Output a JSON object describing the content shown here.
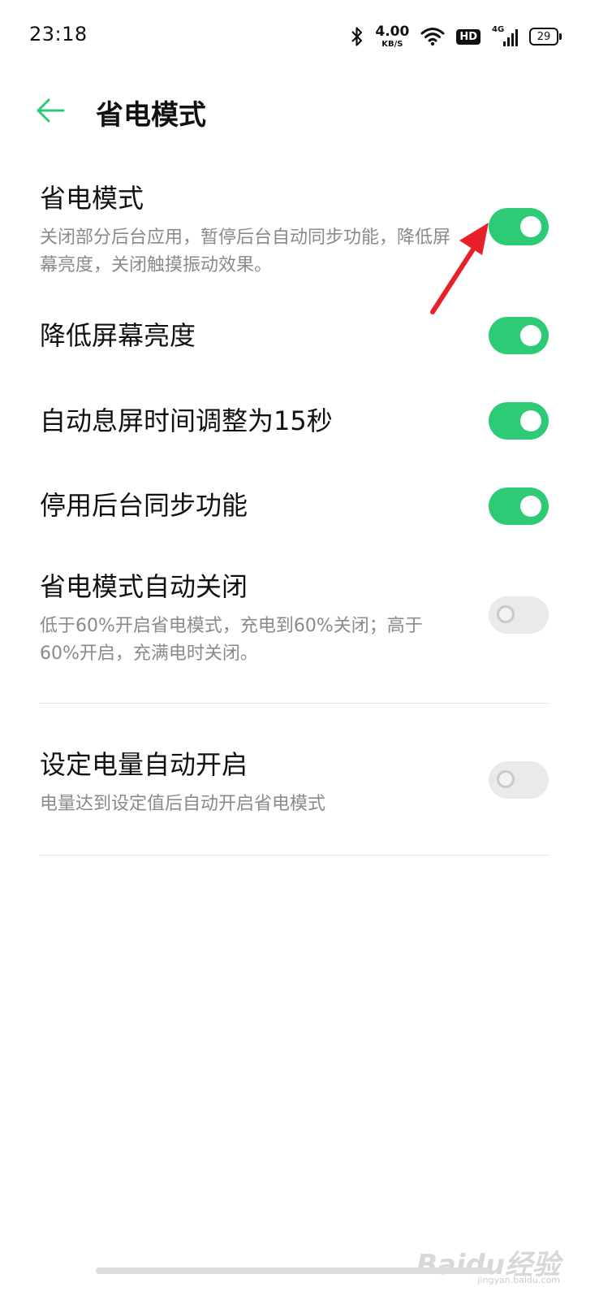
{
  "status_bar": {
    "time": "23:18",
    "net_speed_value": "4.00",
    "net_speed_unit": "KB/S",
    "hd_label": "HD",
    "network_type": "4G",
    "battery_level": "29"
  },
  "header": {
    "title": "省电模式"
  },
  "settings": {
    "power_saving": {
      "title": "省电模式",
      "desc": "关闭部分后台应用，暂停后台自动同步功能，降低屏幕亮度，关闭触摸振动效果。",
      "enabled": true
    },
    "lower_brightness": {
      "title": "降低屏幕亮度",
      "enabled": true
    },
    "screen_timeout": {
      "title": "自动息屏时间调整为15秒",
      "enabled": true
    },
    "disable_sync": {
      "title": "停用后台同步功能",
      "enabled": true
    },
    "auto_off": {
      "title": "省电模式自动关闭",
      "desc": "低于60%开启省电模式，充电到60%关闭；高于60%开启，充满电时关闭。",
      "enabled": false
    },
    "auto_on_level": {
      "title": "设定电量自动开启",
      "desc": "电量达到设定值后自动开启省电模式",
      "enabled": false
    }
  },
  "watermark": {
    "text": "Baidu经验",
    "url": "jingyan.baidu.com"
  },
  "colors": {
    "accent": "#2ecb77",
    "annotation_arrow": "#e8202a"
  }
}
